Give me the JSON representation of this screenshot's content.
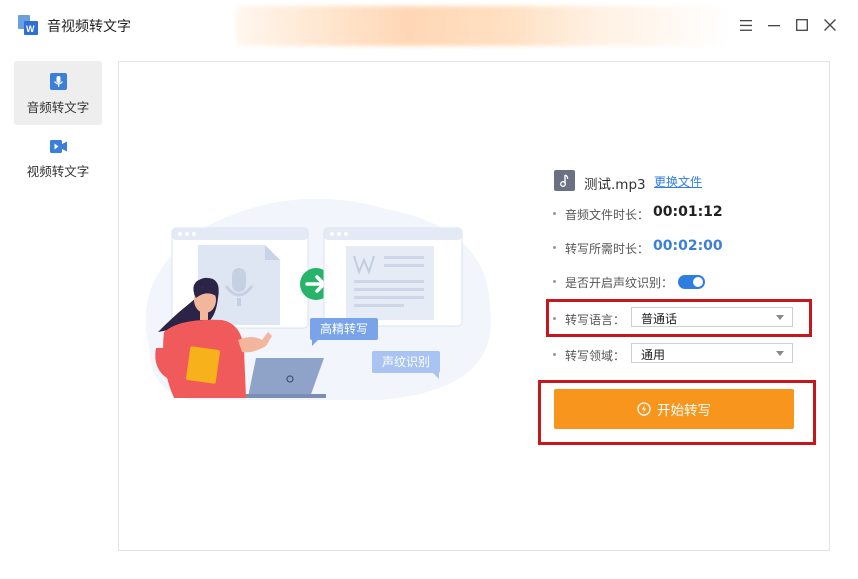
{
  "app": {
    "title": "音视频转文字",
    "logo_icon": "app-logo-icon"
  },
  "window_controls": {
    "menu_icon": "menu-icon",
    "minimize_icon": "minimize-icon",
    "maximize_icon": "maximize-icon",
    "close_icon": "close-icon"
  },
  "sidebar": {
    "items": [
      {
        "label": "音频转文字",
        "icon": "microphone-icon",
        "active": true
      },
      {
        "label": "视频转文字",
        "icon": "video-camera-icon",
        "active": false
      }
    ]
  },
  "illustration": {
    "tag_precision": "高精转写",
    "tag_voiceprint": "声纹识别"
  },
  "file": {
    "name": "测试.mp3",
    "change_link": "更换文件",
    "icon": "music-file-icon"
  },
  "info": {
    "duration_label": "音频文件时长：",
    "duration_value": "00:01:12",
    "required_label": "转写所需时长：",
    "required_value": "00:02:00",
    "voiceprint_label": "是否开启声纹识别：",
    "voiceprint_enabled": true,
    "language_label": "转写语言：",
    "language_value": "普通话",
    "domain_label": "转写领域：",
    "domain_value": "通用"
  },
  "actions": {
    "start_label": "开始转写",
    "start_icon": "start-icon"
  },
  "colors": {
    "accent_orange": "#f7951c",
    "accent_blue": "#2f7de1",
    "highlight_red": "#c8161d",
    "badge_green": "#27b36a"
  }
}
